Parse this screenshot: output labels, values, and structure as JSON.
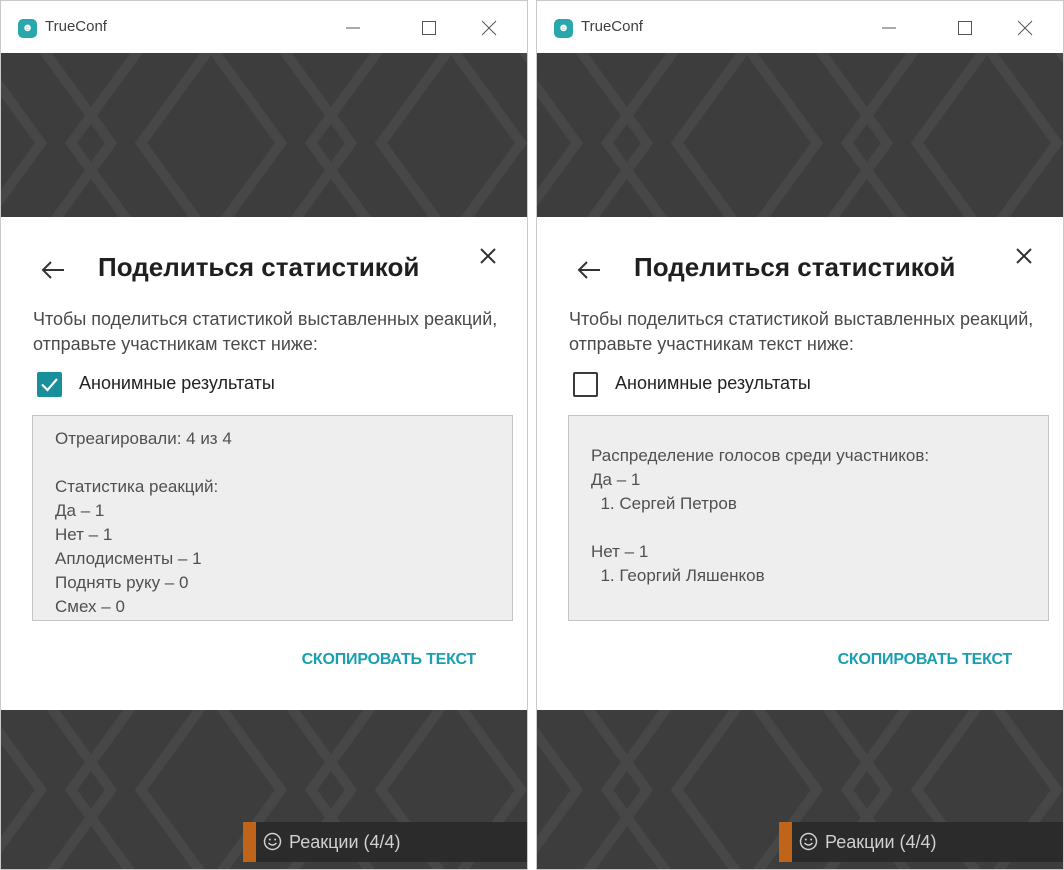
{
  "colors": {
    "accent": "#1a9fb0",
    "checkbox_checked": "#1a8f9c",
    "background_pattern": "#3d3d3d",
    "reactions_accent": "#c0641a"
  },
  "windows": [
    {
      "app_title": "TrueConf",
      "icons": {
        "app": "trueconf-logo-icon",
        "minimize": "minimize-icon",
        "maximize": "maximize-icon",
        "close": "close-icon"
      },
      "dialog": {
        "title": "Поделиться статистикой",
        "description": "Чтобы поделиться статистикой выставленных реакций, отправьте участникам текст ниже:",
        "checkbox_label": "Анонимные результаты",
        "checkbox_checked": true,
        "text_lines": [
          "Отреагировали: 4 из 4",
          "",
          "Статистика реакций:",
          "Да – 1",
          "Нет – 1",
          "Аплодисменты – 1",
          "Поднять руку – 0",
          "Смех – 0"
        ],
        "copy_button": "СКОПИРОВАТЬ ТЕКСТ"
      },
      "reactions_label": "Реакции (4/4)"
    },
    {
      "app_title": "TrueConf",
      "icons": {
        "app": "trueconf-logo-icon",
        "minimize": "minimize-icon",
        "maximize": "maximize-icon",
        "close": "close-icon"
      },
      "dialog": {
        "title": "Поделиться статистикой",
        "description": "Чтобы поделиться статистикой выставленных реакций, отправьте участникам текст ниже:",
        "checkbox_label": "Анонимные результаты",
        "checkbox_checked": false,
        "text_lines": [
          "Распределение голосов среди участников:",
          "Да – 1",
          "  1. Сергей Петров",
          "",
          "Нет – 1",
          "  1. Георгий Ляшенков"
        ],
        "copy_button": "СКОПИРОВАТЬ ТЕКСТ"
      },
      "reactions_label": "Реакции (4/4)"
    }
  ]
}
